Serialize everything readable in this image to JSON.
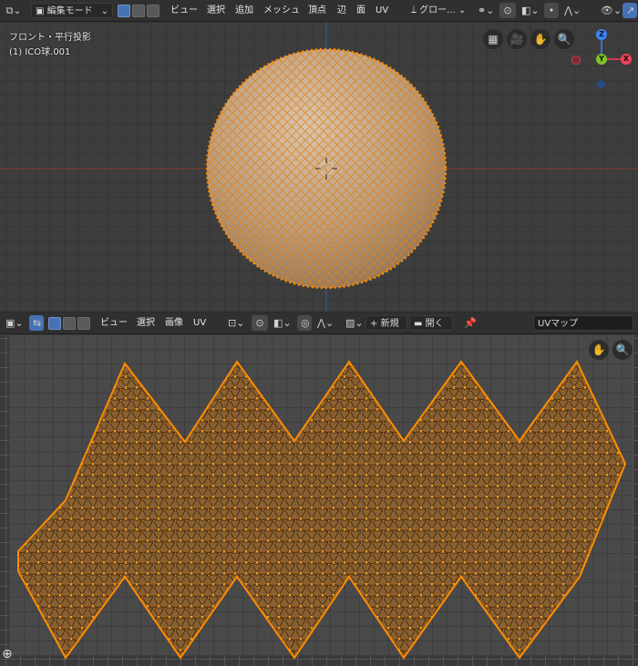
{
  "viewport": {
    "mode_label": "編集モード",
    "menu": [
      "ビュー",
      "選択",
      "追加",
      "メッシュ",
      "頂点",
      "辺",
      "面",
      "UV"
    ],
    "transform_orientation": "グロー...",
    "overlay_line1": "フロント・平行投影",
    "overlay_line2": "(1) ICO球.001",
    "gizmo": {
      "z": "Z",
      "y": "Y",
      "x": "X"
    },
    "nav_icons": [
      "grid-icon",
      "camera-icon",
      "hand-icon",
      "zoom-icon"
    ]
  },
  "uv_editor": {
    "menu": [
      "ビュー",
      "選択",
      "画像",
      "UV"
    ],
    "new_label": "新規",
    "open_label": "開く",
    "uv_map_name": "UVマップ",
    "new_plus": "+"
  },
  "colors": {
    "accent_blue": "#4772b3",
    "mesh_fill": "#b99c7c",
    "vertex_orange": "#ff8c00",
    "uv_fill": "#8a6030"
  }
}
